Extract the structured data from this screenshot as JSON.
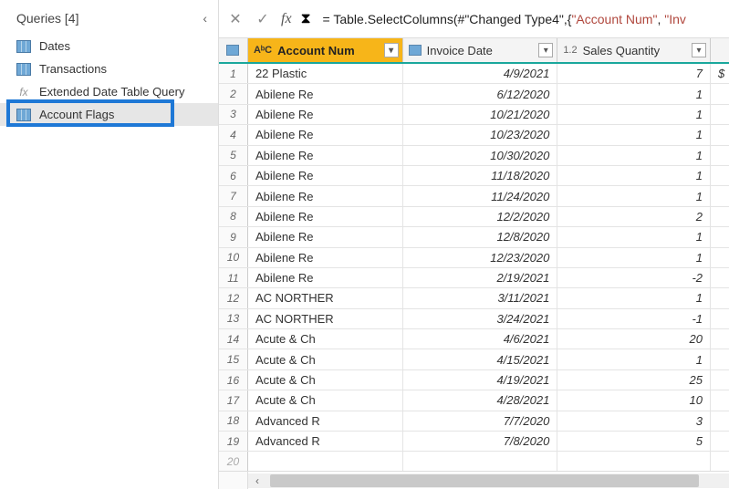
{
  "sidebar": {
    "title": "Queries [4]",
    "items": [
      {
        "label": "Dates",
        "icon": "table"
      },
      {
        "label": "Transactions",
        "icon": "table"
      },
      {
        "label": "Extended Date Table Query",
        "icon": "fx"
      },
      {
        "label": "Account Flags",
        "icon": "table"
      }
    ],
    "selected_index": 3
  },
  "formula": {
    "prefix": "= Table.SelectColumns(#",
    "arg1": "\"Changed Type4\"",
    "mid": ",{",
    "str1": "\"Account Num\"",
    "sep": ", ",
    "str2": "\"Inv"
  },
  "columns": {
    "account": {
      "type": "AᵇC",
      "label": "Account Num"
    },
    "invoice": {
      "type": "",
      "label": "Invoice Date"
    },
    "qty": {
      "type": "1.2",
      "label": "Sales Quantity"
    }
  },
  "rows": [
    {
      "n": "1",
      "account": "22 Plastic",
      "invoice": "4/9/2021",
      "qty": "7",
      "extra": "$"
    },
    {
      "n": "2",
      "account": "Abilene Re",
      "invoice": "6/12/2020",
      "qty": "1",
      "extra": ""
    },
    {
      "n": "3",
      "account": "Abilene Re",
      "invoice": "10/21/2020",
      "qty": "1",
      "extra": ""
    },
    {
      "n": "4",
      "account": "Abilene Re",
      "invoice": "10/23/2020",
      "qty": "1",
      "extra": ""
    },
    {
      "n": "5",
      "account": "Abilene Re",
      "invoice": "10/30/2020",
      "qty": "1",
      "extra": ""
    },
    {
      "n": "6",
      "account": "Abilene Re",
      "invoice": "11/18/2020",
      "qty": "1",
      "extra": ""
    },
    {
      "n": "7",
      "account": "Abilene Re",
      "invoice": "11/24/2020",
      "qty": "1",
      "extra": ""
    },
    {
      "n": "8",
      "account": "Abilene Re",
      "invoice": "12/2/2020",
      "qty": "2",
      "extra": ""
    },
    {
      "n": "9",
      "account": "Abilene Re",
      "invoice": "12/8/2020",
      "qty": "1",
      "extra": ""
    },
    {
      "n": "10",
      "account": "Abilene Re",
      "invoice": "12/23/2020",
      "qty": "1",
      "extra": ""
    },
    {
      "n": "11",
      "account": "Abilene Re",
      "invoice": "2/19/2021",
      "qty": "-2",
      "extra": ""
    },
    {
      "n": "12",
      "account": "AC NORTHER",
      "invoice": "3/11/2021",
      "qty": "1",
      "extra": ""
    },
    {
      "n": "13",
      "account": "AC NORTHER",
      "invoice": "3/24/2021",
      "qty": "-1",
      "extra": ""
    },
    {
      "n": "14",
      "account": "Acute & Ch",
      "invoice": "4/6/2021",
      "qty": "20",
      "extra": ""
    },
    {
      "n": "15",
      "account": "Acute & Ch",
      "invoice": "4/15/2021",
      "qty": "1",
      "extra": ""
    },
    {
      "n": "16",
      "account": "Acute & Ch",
      "invoice": "4/19/2021",
      "qty": "25",
      "extra": ""
    },
    {
      "n": "17",
      "account": "Acute & Ch",
      "invoice": "4/28/2021",
      "qty": "10",
      "extra": ""
    },
    {
      "n": "18",
      "account": "Advanced R",
      "invoice": "7/7/2020",
      "qty": "3",
      "extra": ""
    },
    {
      "n": "19",
      "account": "Advanced R",
      "invoice": "7/8/2020",
      "qty": "5",
      "extra": ""
    },
    {
      "n": "20",
      "account": "",
      "invoice": "",
      "qty": "",
      "extra": ""
    }
  ]
}
